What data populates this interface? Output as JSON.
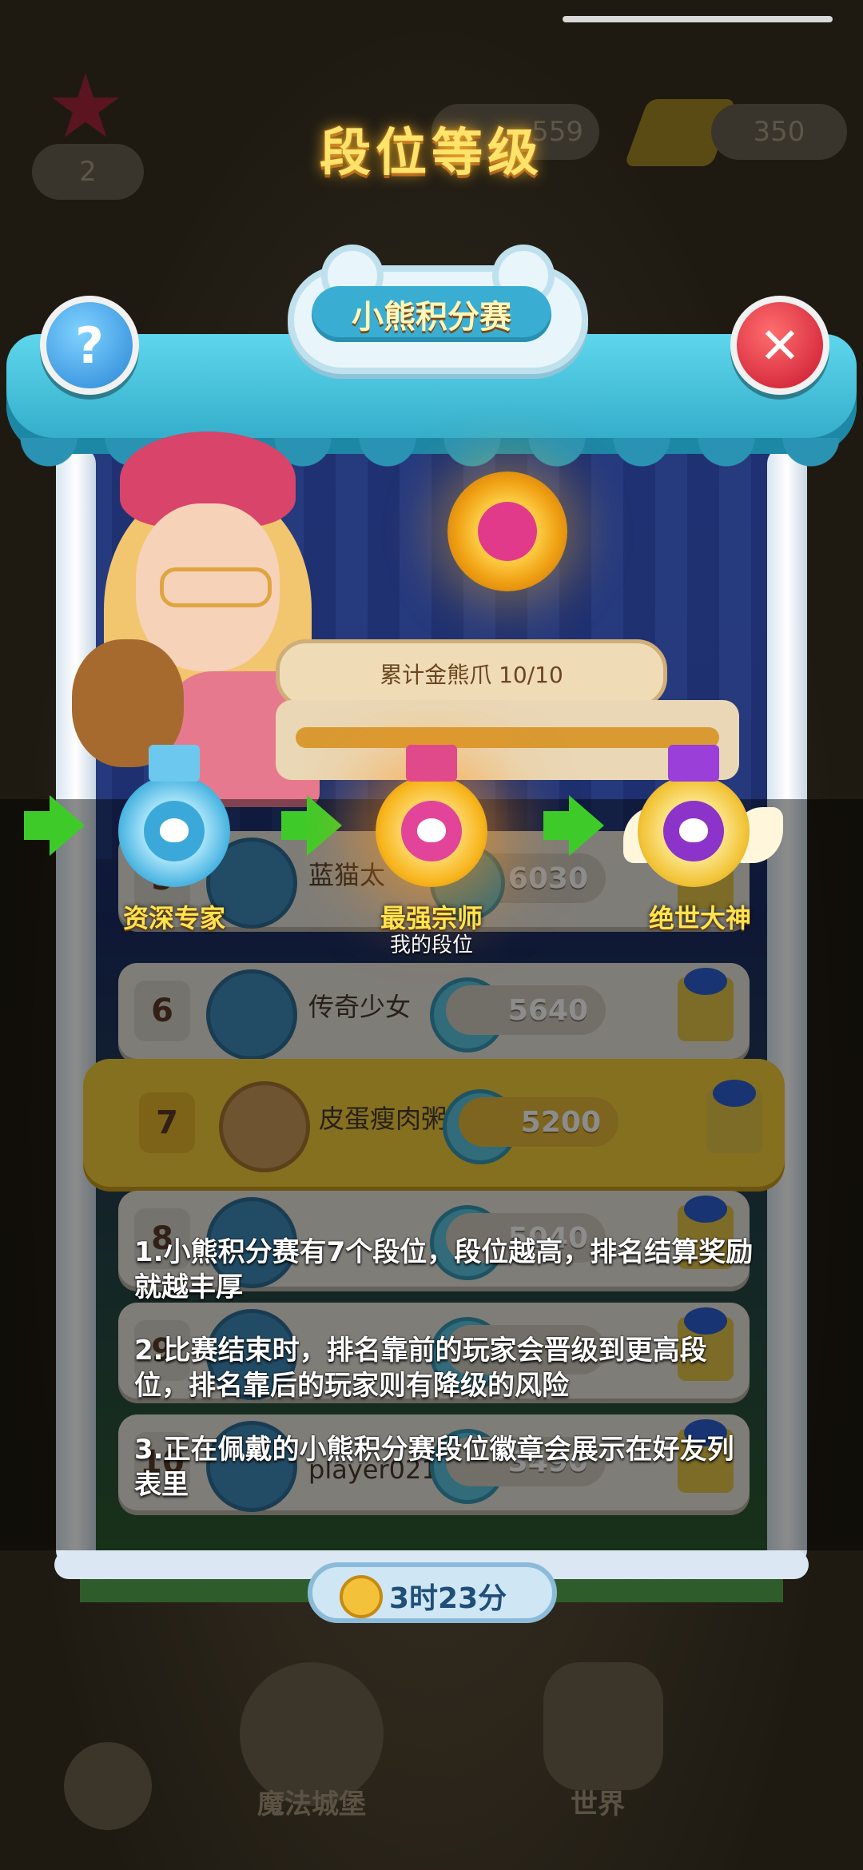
{
  "overlay": {
    "title": "段位等级"
  },
  "hud": {
    "star_count": "2",
    "coins": "559",
    "gems": "350"
  },
  "panel": {
    "header": "小熊积分赛",
    "help_symbol": "?",
    "close_symbol": "✕",
    "progress_label": "累计金熊爪 10/10",
    "progress_fraction": 1.0,
    "timer": "3时23分"
  },
  "leaderboard": {
    "rows": [
      {
        "rank": "5",
        "name": "蓝猫太",
        "score": "6030"
      },
      {
        "rank": "6",
        "name": "传奇少女",
        "score": "5640"
      },
      {
        "rank": "7",
        "name": "皮蛋瘦肉粥",
        "score": "5200"
      },
      {
        "rank": "8",
        "name": "",
        "score": "5040"
      },
      {
        "rank": "9",
        "name": "",
        "score": ""
      },
      {
        "rank": "10",
        "name": "player0215",
        "score": "3490"
      }
    ]
  },
  "tiers": [
    {
      "label": "资深专家",
      "sub": ""
    },
    {
      "label": "最强宗师",
      "sub": "我的段位"
    },
    {
      "label": "绝世大神",
      "sub": ""
    }
  ],
  "rules": [
    "1.小熊积分赛有7个段位，段位越高，排名结算奖励就越丰厚",
    "2.比赛结束时，排名靠前的玩家会晋级到更高段位，排名靠后的玩家则有降级的风险",
    "3.正在佩戴的小熊积分赛段位徽章会展示在好友列表里"
  ],
  "bottom_nav": {
    "left_label": "魔法城堡",
    "right_label": "世界"
  },
  "colors": {
    "title": "#ffe36a",
    "tier_label": "#ffe44d",
    "arrow": "#3ecb2a",
    "awning": "#3fb9d8"
  }
}
